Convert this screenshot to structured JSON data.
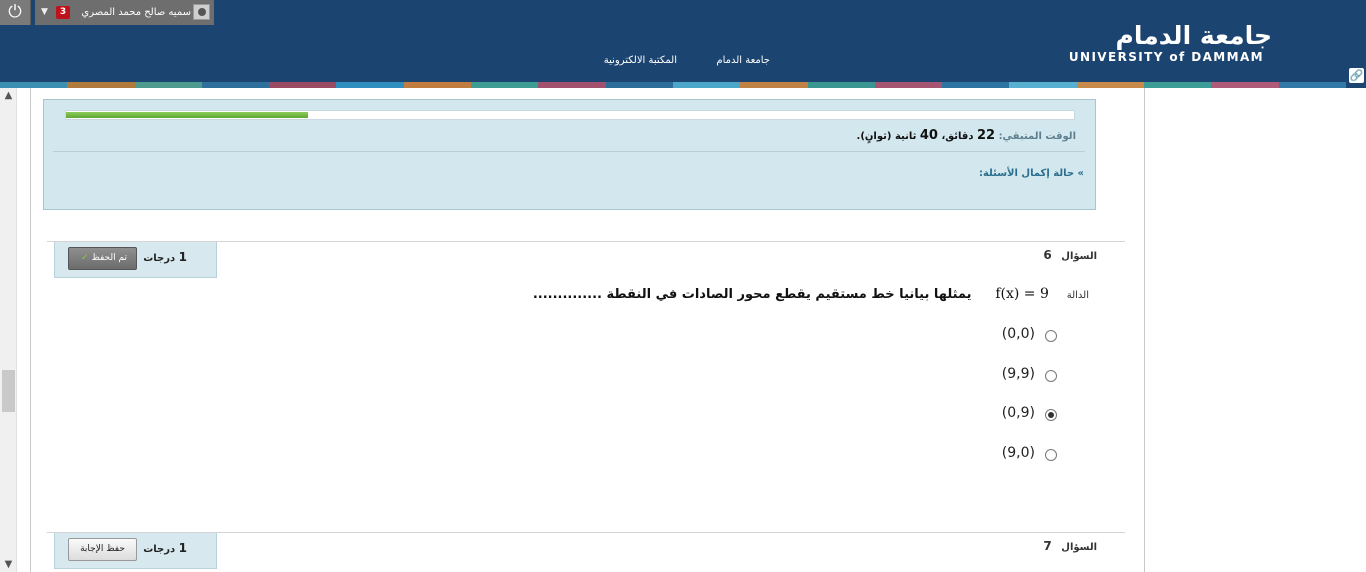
{
  "header": {
    "user_name": "سميه صالح محمد المصري",
    "notification_count": "3",
    "logo_arabic": "جامعة الدمام",
    "logo_english": "UNIVERSITY of DAMMAM",
    "nav": [
      "جامعة الدمام",
      "المكتبة الالكترونية"
    ],
    "stripe_colors": [
      "#3b8fb0",
      "#b07a3c",
      "#4d9a8e",
      "#2e6f9b",
      "#9a4a63",
      "#2f8fc0",
      "#c07d3f",
      "#3e9d93",
      "#a1506d",
      "#2c6d99",
      "#4aa7c9",
      "#c08244",
      "#3a9690",
      "#a55572",
      "#2e74a2",
      "#57b0d0",
      "#c78a4b",
      "#3c9d97",
      "#ad5b78",
      "#3279a8"
    ]
  },
  "timer": {
    "progress_percent": 24,
    "label": "الوقت المتبقي:",
    "minutes": "22",
    "minutes_unit": "دقائق،",
    "seconds": "40",
    "seconds_unit": "ثانية (ثوانٍ).",
    "status_link": "حالة إكمال الأسئلة:"
  },
  "questions": [
    {
      "label": "السؤال",
      "number": "6",
      "points": "1",
      "points_unit": "درجات",
      "save_label": "تم الحفظ",
      "pre": "الدالة",
      "math": "f(x) = 9",
      "stem": "يمثلها بيانيا خط مستقيم يقطع محور الصادات في النقطة ..............",
      "options": [
        "(0,0)",
        "(9,9)",
        "(0,9)",
        "(9,0)"
      ],
      "selected": 2
    },
    {
      "label": "السؤال",
      "number": "7",
      "points": "1",
      "points_unit": "درجات",
      "save_label": "حفظ الإجابة"
    }
  ],
  "icons": {
    "power": "power-icon",
    "dropdown": "chevron-down-icon",
    "avatar": "avatar-icon",
    "lock": "lock-icon",
    "collapse": "double-chevron-icon",
    "check": "check-icon"
  }
}
